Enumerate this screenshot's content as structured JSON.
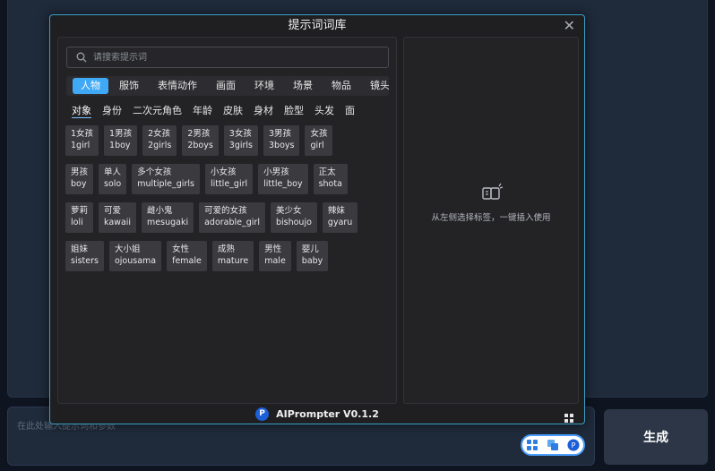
{
  "background": {
    "input_placeholder": "在此处输入提示词和参数",
    "generate_label": "生成"
  },
  "dialog": {
    "title": "提示词词库",
    "close": "✕",
    "search_placeholder": "请搜索提示词",
    "categories": [
      "人物",
      "服饰",
      "表情动作",
      "画面",
      "环境",
      "场景",
      "物品",
      "镜头"
    ],
    "active_category": "人物",
    "subcategories": [
      "对象",
      "身份",
      "二次元角色",
      "年龄",
      "皮肤",
      "身材",
      "脸型",
      "头发",
      "面"
    ],
    "active_subcategory": "对象",
    "tag_rows": [
      [
        {
          "zh": "1女孩",
          "en": "1girl"
        },
        {
          "zh": "1男孩",
          "en": "1boy"
        },
        {
          "zh": "2女孩",
          "en": "2girls"
        },
        {
          "zh": "2男孩",
          "en": "2boys"
        },
        {
          "zh": "3女孩",
          "en": "3girls"
        },
        {
          "zh": "3男孩",
          "en": "3boys"
        },
        {
          "zh": "女孩",
          "en": "girl"
        }
      ],
      [
        {
          "zh": "男孩",
          "en": "boy"
        },
        {
          "zh": "单人",
          "en": "solo"
        },
        {
          "zh": "多个女孩",
          "en": "multiple_girls"
        },
        {
          "zh": "小女孩",
          "en": "little_girl"
        },
        {
          "zh": "小男孩",
          "en": "little_boy"
        },
        {
          "zh": "正太",
          "en": "shota"
        }
      ],
      [
        {
          "zh": "萝莉",
          "en": "loli"
        },
        {
          "zh": "可爱",
          "en": "kawaii"
        },
        {
          "zh": "雌小鬼",
          "en": "mesugaki"
        },
        {
          "zh": "可爱的女孩",
          "en": "adorable_girl"
        },
        {
          "zh": "美少女",
          "en": "bishoujo"
        },
        {
          "zh": "辣妹",
          "en": "gyaru"
        }
      ],
      [
        {
          "zh": "姐妹",
          "en": "sisters"
        },
        {
          "zh": "大小姐",
          "en": "ojousama"
        },
        {
          "zh": "女性",
          "en": "female"
        },
        {
          "zh": "成熟",
          "en": "mature"
        },
        {
          "zh": "男性",
          "en": "male"
        },
        {
          "zh": "婴儿",
          "en": "baby"
        }
      ]
    ],
    "hint_text": "从左侧选择标签，一键插入使用",
    "footer_label": "AIPrompter V0.1.2",
    "logo_letter": "P"
  },
  "colors": {
    "accent": "#3fa9f5",
    "modal_border": "#3aa0c8"
  },
  "icons": {
    "search": "search-icon",
    "hint": "book-sparkle-icon",
    "grid": "grid-icon"
  }
}
